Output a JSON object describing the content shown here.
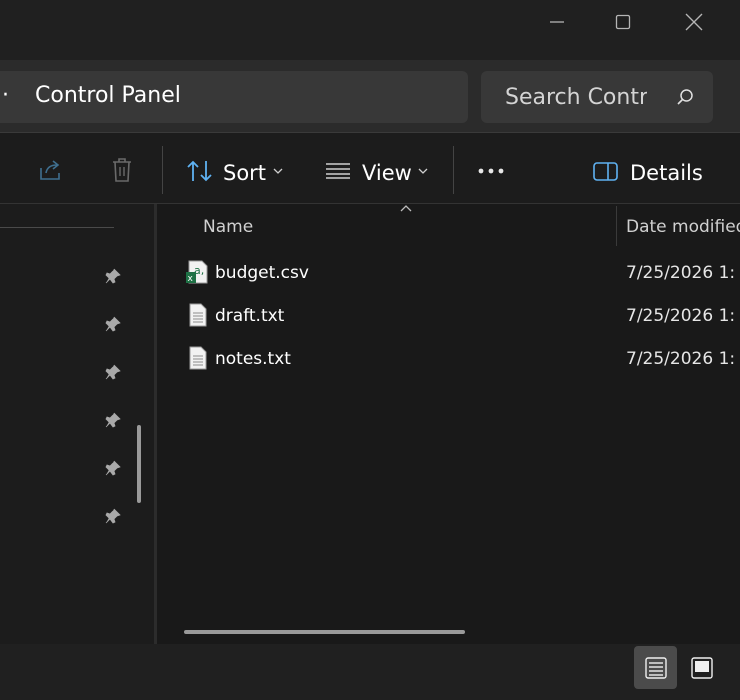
{
  "window": {
    "controls": {
      "minimize": "minimize",
      "maximize": "maximize",
      "close": "close"
    }
  },
  "address": {
    "dots": "·",
    "text": "Control Panel"
  },
  "search": {
    "text": "Search Control Panel"
  },
  "toolbar": {
    "sort_label": "Sort",
    "view_label": "View",
    "more_label": "•••",
    "details_label": "Details"
  },
  "columns": {
    "name": "Name",
    "date_modified": "Date modified"
  },
  "files": [
    {
      "name": "budget.csv",
      "date": "7/25/2026 1:",
      "icon": "csv-file-icon"
    },
    {
      "name": "draft.txt",
      "date": "7/25/2026 1:",
      "icon": "text-file-icon"
    },
    {
      "name": "notes.txt",
      "date": "7/25/2026 1:",
      "icon": "text-file-icon"
    }
  ],
  "colors": {
    "accent": "#5fb2f2",
    "background": "#191919",
    "excel_green": "#1e7145"
  }
}
